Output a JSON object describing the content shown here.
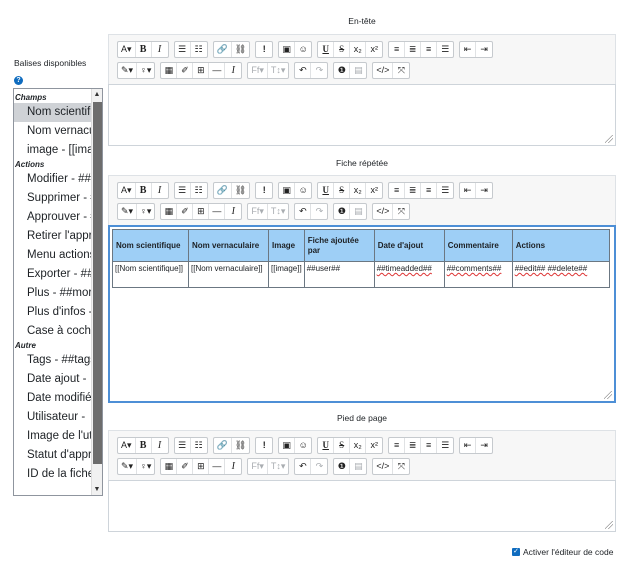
{
  "tags_panel": {
    "title": "Balises disponibles",
    "help_icon": "question-circle-icon",
    "groups": [
      {
        "label": "Champs",
        "items": [
          "Nom scientifique",
          "Nom vernaculaire",
          "image - [[image]]"
        ]
      },
      {
        "label": "Actions",
        "items": [
          "Modifier - ##edit##",
          "Supprimer - ##delete##",
          "Approuver - ##approve##",
          "Retirer l'approbation",
          "Menu actions",
          "Exporter - ##export##",
          "Plus - ##more##",
          "Plus d'infos -",
          "Case à cocher"
        ]
      },
      {
        "label": "Autre",
        "items": [
          "Tags - ##tags##",
          "Date ajout -",
          "Date modifiée",
          "Utilisateur -",
          "Image de l'utilisateur",
          "Statut d'approbation",
          "ID de la fiche"
        ]
      }
    ],
    "selected_item": "Nom scientifique"
  },
  "editors": {
    "header_label": "En-tête",
    "repeated_label": "Fiche répétée",
    "footer_label": "Pied de page"
  },
  "toolbar": {
    "row1": [
      [
        "A▾",
        "B",
        "I"
      ],
      [
        "☰",
        "☷"
      ],
      [
        "🔗",
        "⛓"
      ],
      [
        "!"
      ],
      [
        "▣",
        "☺"
      ],
      [
        "U",
        "S",
        "x₂",
        "x²"
      ],
      [
        "≡",
        "≣",
        "≡",
        "☰"
      ],
      [
        "⇤",
        "⇥"
      ]
    ],
    "row2": [
      [
        "✎▾",
        "♀▾"
      ],
      [
        "▦",
        "✐",
        "⊞",
        "—",
        "I"
      ],
      [
        "Ff▾",
        "T↕▾"
      ],
      [
        "↶",
        "↷"
      ],
      [
        "❶",
        "▤"
      ],
      [
        "</>",
        "⤧"
      ]
    ],
    "icons": {
      "row1": [
        [
          "font-color-icon",
          "bold-icon",
          "italic-icon"
        ],
        [
          "unordered-list-icon",
          "ordered-list-icon"
        ],
        [
          "link-icon",
          "unlink-icon"
        ],
        [
          "emoji-warning-icon"
        ],
        [
          "image-icon",
          "emoticon-icon"
        ],
        [
          "underline-icon",
          "strikethrough-icon",
          "subscript-icon",
          "superscript-icon"
        ],
        [
          "align-left-icon",
          "align-center-icon",
          "align-right-icon",
          "align-justify-icon"
        ],
        [
          "outdent-icon",
          "indent-icon"
        ]
      ],
      "row2": [
        [
          "highlight-icon",
          "brush-icon"
        ],
        [
          "calculator-icon",
          "edit-icon",
          "table-icon",
          "horizontal-rule-icon",
          "clear-format-icon"
        ],
        [
          "font-family-icon",
          "font-size-icon"
        ],
        [
          "undo-icon",
          "redo-icon"
        ],
        [
          "accessibility-icon",
          "screenreader-icon"
        ],
        [
          "html-icon",
          "fullscreen-icon"
        ]
      ]
    }
  },
  "repeated_table": {
    "headers": [
      "Nom scientifique",
      "Nom vernaculaire",
      "Image",
      "Fiche ajoutée par",
      "Date d'ajout",
      "Commentaire",
      "Actions"
    ],
    "row": [
      "[[Nom scientifique]]",
      "[[Nom vernaculaire]]",
      "[[image]]",
      "##user##",
      "##timeadded##",
      "##comments##",
      "##edit## ##delete##"
    ]
  },
  "code_editor_checkbox": {
    "label": "Activer l'éditeur de code",
    "checked": true
  }
}
